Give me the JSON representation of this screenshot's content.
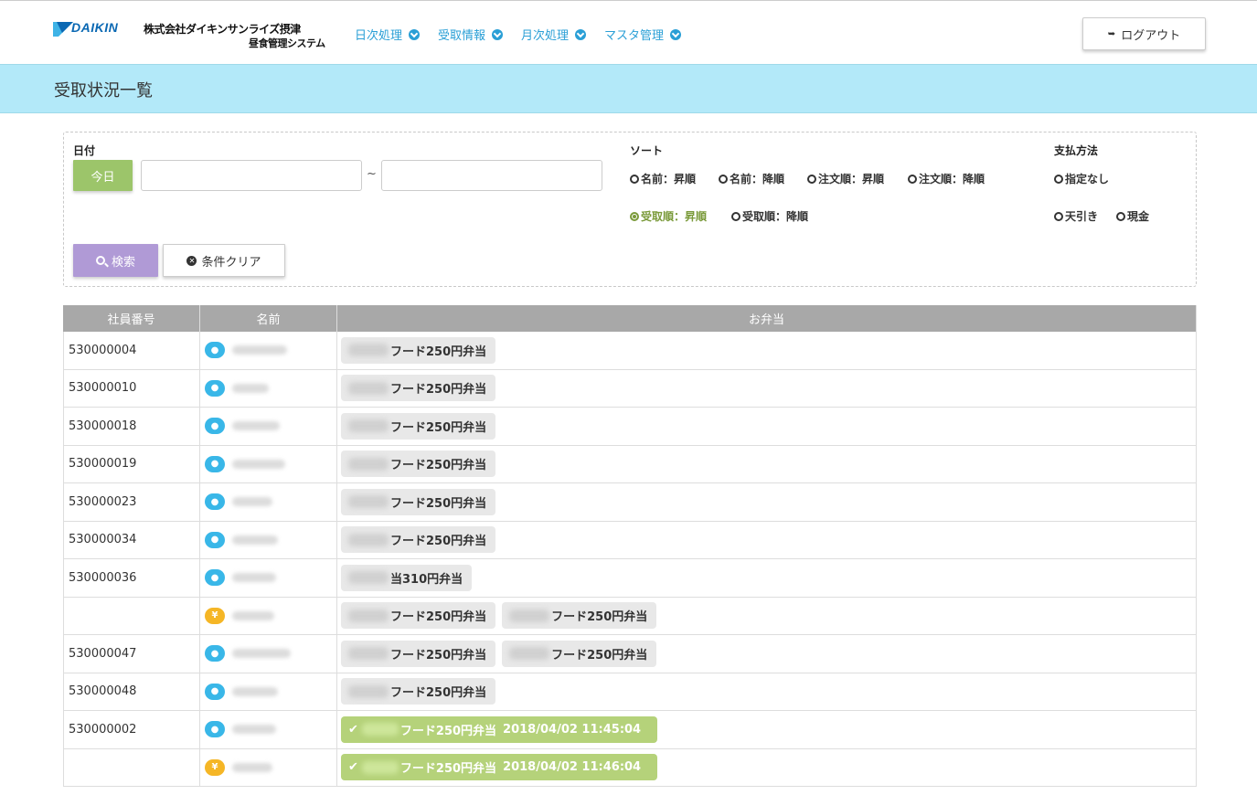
{
  "header": {
    "brand": "DAIKIN",
    "company": "株式会社ダイキンサンライズ摂津",
    "system": "昼食管理システム",
    "nav": [
      {
        "label": "日次処理"
      },
      {
        "label": "受取情報"
      },
      {
        "label": "月次処理"
      },
      {
        "label": "マスタ管理"
      }
    ],
    "logout_label": "ログアウト"
  },
  "page_title": "受取状況一覧",
  "filter": {
    "date_label": "日付",
    "today_label": "今日",
    "date_from": "",
    "date_to": "",
    "tilde": "~",
    "sort_label": "ソート",
    "sort_options": [
      {
        "label": "名前：昇順",
        "checked": false
      },
      {
        "label": "名前：降順",
        "checked": false
      },
      {
        "label": "注文順：昇順",
        "checked": false
      },
      {
        "label": "注文順：降順",
        "checked": false
      },
      {
        "label": "受取順：昇順",
        "checked": true
      },
      {
        "label": "受取順：降順",
        "checked": false
      }
    ],
    "payment_label": "支払方法",
    "payment_options": [
      {
        "label": "指定なし",
        "checked": false
      },
      {
        "label": "天引き",
        "checked": false
      },
      {
        "label": "現金",
        "checked": false
      }
    ],
    "search_label": "検索",
    "clear_label": "条件クリア"
  },
  "table": {
    "headers": [
      "社員番号",
      "名前",
      "お弁当"
    ],
    "rows": [
      {
        "id": "530000004",
        "badge": "person",
        "orders": [
          {
            "name": "フード250円弁当"
          }
        ]
      },
      {
        "id": "530000010",
        "badge": "person",
        "orders": [
          {
            "name": "フード250円弁当"
          }
        ]
      },
      {
        "id": "530000018",
        "badge": "person",
        "orders": [
          {
            "name": "フード250円弁当"
          }
        ]
      },
      {
        "id": "530000019",
        "badge": "person",
        "orders": [
          {
            "name": "フード250円弁当"
          }
        ]
      },
      {
        "id": "530000023",
        "badge": "person",
        "orders": [
          {
            "name": "フード250円弁当"
          }
        ]
      },
      {
        "id": "530000034",
        "badge": "person",
        "orders": [
          {
            "name": "フード250円弁当"
          }
        ]
      },
      {
        "id": "530000036",
        "badge": "person",
        "orders": [
          {
            "name": "当310円弁当"
          }
        ]
      },
      {
        "id": "",
        "badge": "yen",
        "orders": [
          {
            "name": "フード250円弁当"
          },
          {
            "name": "フード250円弁当"
          }
        ]
      },
      {
        "id": "530000047",
        "badge": "person",
        "orders": [
          {
            "name": "フード250円弁当"
          },
          {
            "name": "フード250円弁当"
          }
        ]
      },
      {
        "id": "530000048",
        "badge": "person",
        "orders": [
          {
            "name": "フード250円弁当"
          }
        ]
      },
      {
        "id": "530000002",
        "badge": "person",
        "orders": [
          {
            "name": "フード250円弁当",
            "done": true,
            "time": "2018/04/02 11:45:04"
          }
        ]
      },
      {
        "id": "",
        "badge": "yen",
        "orders": [
          {
            "name": "フード250円弁当",
            "done": true,
            "time": "2018/04/02 11:46:04"
          }
        ]
      }
    ]
  }
}
